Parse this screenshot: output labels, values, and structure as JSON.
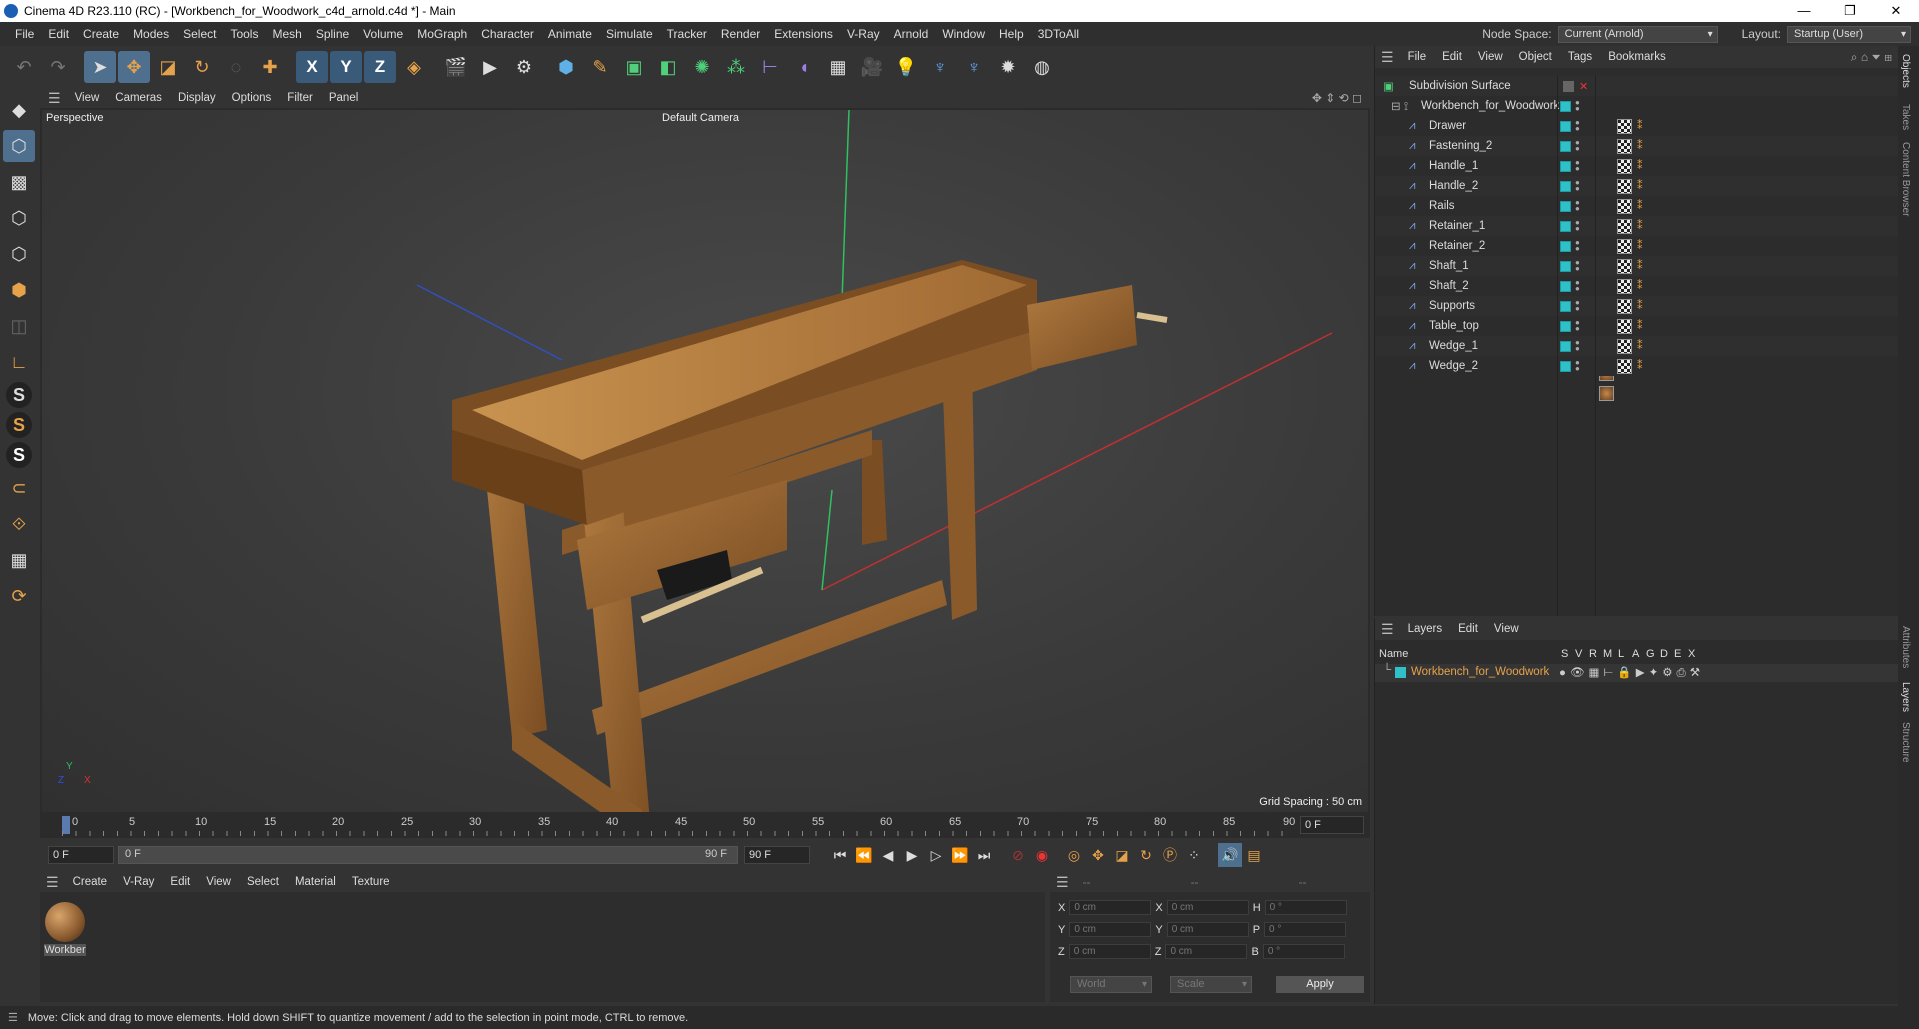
{
  "titlebar": {
    "title": "Cinema 4D R23.110 (RC) - [Workbench_for_Woodwork_c4d_arnold.c4d *] - Main",
    "minimize": "—",
    "maximize": "❐",
    "close": "✕"
  },
  "menu": [
    "File",
    "Edit",
    "Create",
    "Modes",
    "Select",
    "Tools",
    "Mesh",
    "Spline",
    "Volume",
    "MoGraph",
    "Character",
    "Animate",
    "Simulate",
    "Tracker",
    "Render",
    "Extensions",
    "V-Ray",
    "Arnold",
    "Window",
    "Help",
    "3DToAll"
  ],
  "node_space": {
    "label": "Node Space:",
    "value": "Current (Arnold)"
  },
  "layout": {
    "label": "Layout:",
    "value": "Startup (User)"
  },
  "toolbar": {
    "axis_x": "X",
    "axis_y": "Y",
    "axis_z": "Z"
  },
  "viewport": {
    "menu": [
      "View",
      "Cameras",
      "Display",
      "Options",
      "Filter",
      "Panel"
    ],
    "label": "Perspective",
    "camera": "Default Camera",
    "grid_spacing": "Grid Spacing : 50 cm",
    "axis_y": "Y",
    "axis_z": "Z",
    "axis_x": "X"
  },
  "timeline": {
    "ticks": [
      "0",
      "5",
      "10",
      "15",
      "20",
      "25",
      "30",
      "35",
      "40",
      "45",
      "50",
      "55",
      "60",
      "65",
      "70",
      "75",
      "80",
      "85",
      "90"
    ],
    "current_frame": "0 F"
  },
  "transport": {
    "start": "0 F",
    "range_start": "0 F",
    "range_end": "90 F",
    "end": "90 F"
  },
  "materials": {
    "menu": [
      "Create",
      "V-Ray",
      "Edit",
      "View",
      "Select",
      "Material",
      "Texture"
    ],
    "items": [
      {
        "label": "Workber"
      }
    ]
  },
  "coords": {
    "headers": [
      "--",
      "--",
      "--"
    ],
    "rows": [
      {
        "a": "X",
        "av": "0 cm",
        "b": "X",
        "bv": "0 cm",
        "c": "H",
        "cv": "0 °"
      },
      {
        "a": "Y",
        "av": "0 cm",
        "b": "Y",
        "bv": "0 cm",
        "c": "P",
        "cv": "0 °"
      },
      {
        "a": "Z",
        "av": "0 cm",
        "b": "Z",
        "bv": "0 cm",
        "c": "B",
        "cv": "0 °"
      }
    ],
    "world": "World",
    "scale": "Scale",
    "apply": "Apply"
  },
  "objects": {
    "menu": [
      "File",
      "Edit",
      "View",
      "Object",
      "Tags",
      "Bookmarks"
    ],
    "root": "Subdivision Surface",
    "group": "Workbench_for_Woodwork",
    "children": [
      "Drawer",
      "Fastening_2",
      "Handle_1",
      "Handle_2",
      "Rails",
      "Retainer_1",
      "Retainer_2",
      "Shaft_1",
      "Shaft_2",
      "Supports",
      "Table_top",
      "Wedge_1",
      "Wedge_2"
    ]
  },
  "layers": {
    "menu": [
      "Layers",
      "Edit",
      "View"
    ],
    "col_name": "Name",
    "cols": [
      "S",
      "V",
      "R",
      "M",
      "L",
      "A",
      "G",
      "D",
      "E",
      "X"
    ],
    "item": "Workbench_for_Woodwork"
  },
  "right_tabs": [
    "Objects",
    "Takes",
    "Content Browser",
    "Attributes",
    "Layers",
    "Structure"
  ],
  "status": "Move: Click and drag to move elements. Hold down SHIFT to quantize movement / add to the selection in point mode, CTRL to remove.",
  "colors": {
    "teal": "#2fc0c8",
    "accent": "#e6a24a",
    "wood": "#9a6a38"
  }
}
